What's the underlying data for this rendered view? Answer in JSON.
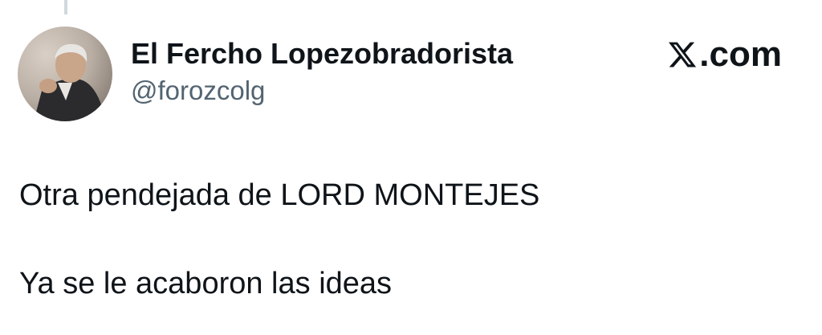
{
  "author": {
    "display_name": "El Fercho Lopezobradorista",
    "handle": "@forozcolg",
    "avatar_icon": "user-avatar-photo"
  },
  "brand": {
    "icon": "x-logo-icon",
    "text": ".com"
  },
  "tweet": {
    "lines": [
      "Otra pendejada de LORD MONTEJES",
      "Ya se le acaboron las ideas"
    ]
  },
  "colors": {
    "text_primary": "#0f1419",
    "text_secondary": "#536471",
    "thread_line": "#cfd9de",
    "background": "#ffffff"
  }
}
